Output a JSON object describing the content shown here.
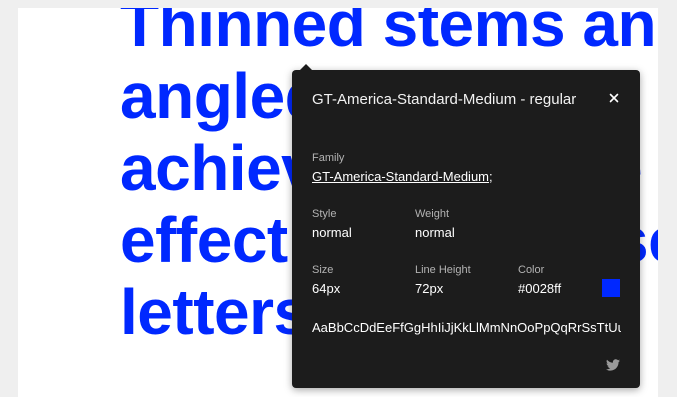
{
  "sample": {
    "text": "Thinned stems and\nangled spurs\nachieve the same\neffect in lowercase\nletters b and p.",
    "color": "#0028ff"
  },
  "popup": {
    "title": "GT-America-Standard-Medium - regular",
    "close_icon": "close-icon",
    "family_label": "Family",
    "family_value": "GT-America-Standard-Medium",
    "family_suffix": ";",
    "style_label": "Style",
    "style_value": "normal",
    "weight_label": "Weight",
    "weight_value": "normal",
    "size_label": "Size",
    "size_value": "64px",
    "line_height_label": "Line Height",
    "line_height_value": "72px",
    "color_label": "Color",
    "color_value": "#0028ff",
    "swatch_color": "#0028ff",
    "alphabet": "AaBbCcDdEeFfGgHhIiJjKkLlMmNnOoPpQqRrSsTtUuVvWwXxYyZz",
    "share_icon": "twitter-icon"
  }
}
